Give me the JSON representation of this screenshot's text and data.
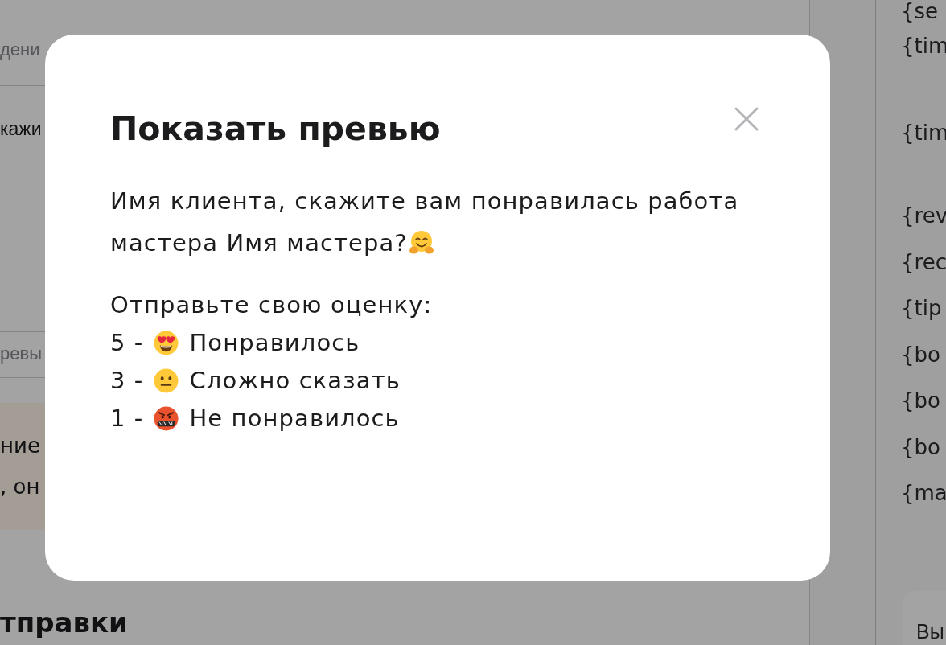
{
  "page": {
    "left_column": {
      "section_label": "дени",
      "message_preview": "кажи",
      "field_label": "ревы",
      "notice": {
        "lines": [
          "ние",
          ", он"
        ]
      },
      "section_title": "тправки"
    },
    "right_column": {
      "variables": [
        "{se",
        "{tim",
        "{tim",
        "{rev",
        "{rec",
        "{tip",
        "{bo",
        "{bo",
        "{bo",
        "{ma"
      ],
      "button": "Вы"
    }
  },
  "preview_dialog": {
    "title": "Показать превью",
    "message_lines": [
      "Имя клиента, скажите вам понравилась работа",
      "мастера Имя мастера?"
    ],
    "prompt": "Отправьте свою оценку:",
    "options": [
      {
        "kind": "love",
        "score": "5 -",
        "label": "Понравилось"
      },
      {
        "kind": "neutral",
        "score": "3 -",
        "label": "Сложно сказать"
      },
      {
        "kind": "angry",
        "score": "1 -",
        "label": "Не понравилось"
      }
    ]
  }
}
